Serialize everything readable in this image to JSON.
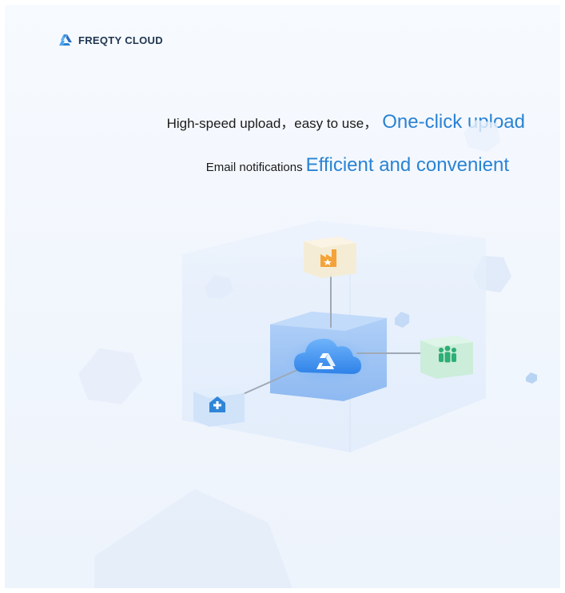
{
  "brand": {
    "name": "FREQTY CLOUD",
    "logo_icon": "freqty-logo-icon",
    "color": "#2a83d3"
  },
  "tagline": {
    "line1_text": "High-speed upload，easy to use，",
    "line1_highlight": "One-click upload",
    "line2_text": "Email notifications",
    "line2_highlight": "Efficient and convenient"
  },
  "illustration": {
    "center_icon": "cloud-logo-icon",
    "top_icon": "factory-icon",
    "right_icon": "people-group-icon",
    "left_icon": "hospital-icon"
  },
  "colors": {
    "accent": "#2a83d3",
    "text": "#1b1b1b",
    "factory": "#f3a33a",
    "people": "#2fae75",
    "hospital": "#2f86d8"
  }
}
